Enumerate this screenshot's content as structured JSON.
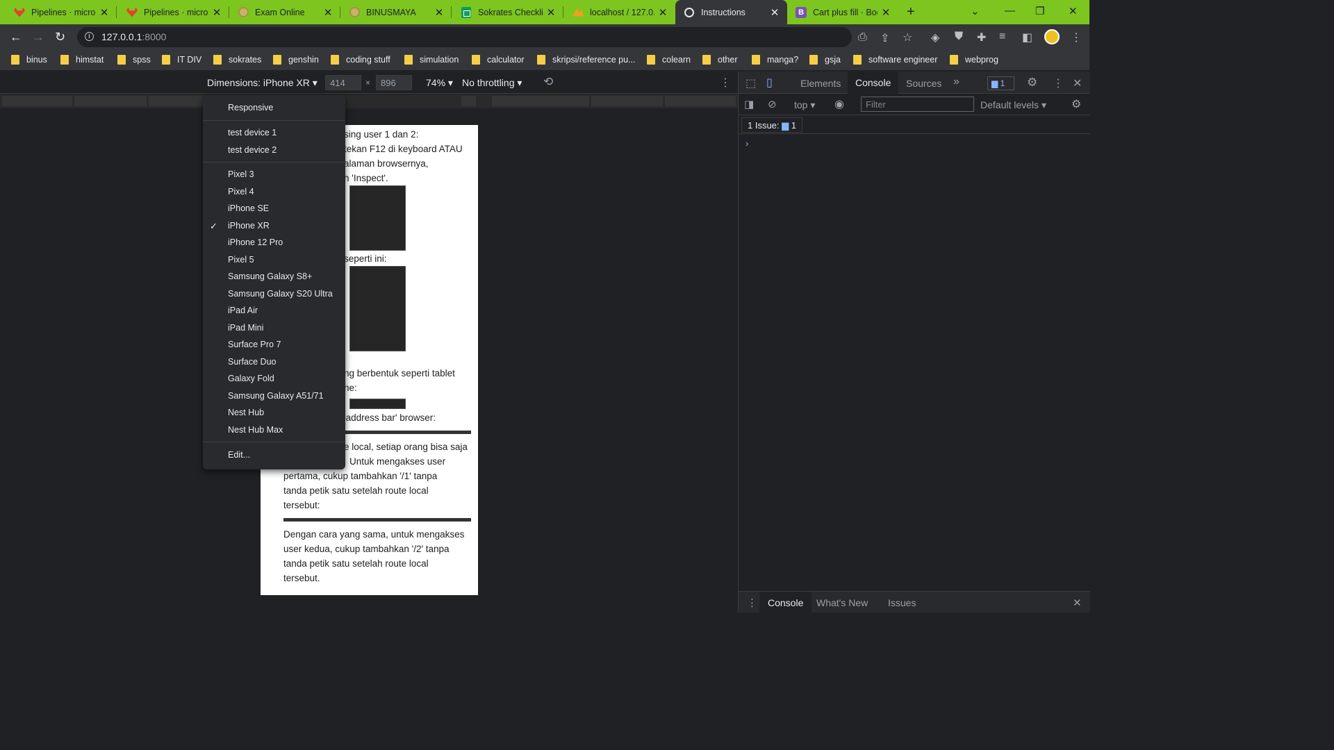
{
  "tabs": [
    {
      "label": "Pipelines · micros",
      "icon": "gitlab-icon"
    },
    {
      "label": "Pipelines · micros",
      "icon": "gitlab-icon"
    },
    {
      "label": "Exam Online",
      "icon": "coin-icon"
    },
    {
      "label": "BINUSMAYA",
      "icon": "coin-icon"
    },
    {
      "label": "Sokrates Checklis",
      "icon": "sheets-icon"
    },
    {
      "label": "localhost / 127.0.0",
      "icon": "phpmyadmin-icon"
    },
    {
      "label": "Instructions",
      "icon": "globe-icon"
    },
    {
      "label": "Cart plus fill · Boo",
      "icon": "bootstrap-icon"
    }
  ],
  "address": {
    "host": "127.0.0.1",
    "port": ":8000"
  },
  "bookmarks": [
    "binus",
    "himstat",
    "spss",
    "IT DIV",
    "sokrates",
    "genshin",
    "coding stuff",
    "simulation",
    "calculator",
    "skripsi/reference pu...",
    "colearn",
    "other",
    "manga?",
    "gsja",
    "software engineer",
    "webprog"
  ],
  "device_toolbar": {
    "dimensions": "Dimensions: iPhone XR",
    "width": "414",
    "height": "896",
    "times": "×",
    "zoom": "74%",
    "throttling": "No throttling"
  },
  "device_menu": {
    "responsive": "Responsive",
    "custom": [
      "test device 1",
      "test device 2"
    ],
    "devices": [
      "Pixel 3",
      "Pixel 4",
      "iPhone SE",
      "iPhone XR",
      "iPhone 12 Pro",
      "Pixel 5",
      "Samsung Galaxy S8+",
      "Samsung Galaxy S20 Ultra",
      "iPad Air",
      "iPad Mini",
      "Surface Pro 7",
      "Surface Duo",
      "Galaxy Fold",
      "Samsung Galaxy A51/71",
      "Nest Hub",
      "Nest Hub Max"
    ],
    "selected": "iPhone XR",
    "edit": "Edit..."
  },
  "page": {
    "lines": [
      "sing user 1 dan 2:",
      "tekan F12 di keyboard ATAU",
      "alaman browsernya,",
      "h 'Inspect'.",
      "seperti ini:",
      "ng berbentuk seperti tablet",
      "ne:",
      "'address bar' browser:",
      "e local, setiap orang bisa saja",
      "Untuk mengakses user",
      "pertama, cukup tambahkan '/1' tanpa",
      "tanda petik satu setelah route local",
      "tersebut:",
      "Dengan cara yang sama, untuk mengakses",
      "user kedua, cukup tambahkan '/2' tanpa",
      "tanda petik satu setelah route local",
      "tersebut."
    ]
  },
  "devtools": {
    "tabs": [
      "Elements",
      "Console",
      "Sources"
    ],
    "issues_count": "1",
    "context": "top",
    "filter_placeholder": "Filter",
    "levels": "Default levels",
    "issues_label": "1 Issue:",
    "issues_num": "1",
    "prompt": "›",
    "drawer_tabs": [
      "Console",
      "What's New",
      "Issues"
    ]
  }
}
